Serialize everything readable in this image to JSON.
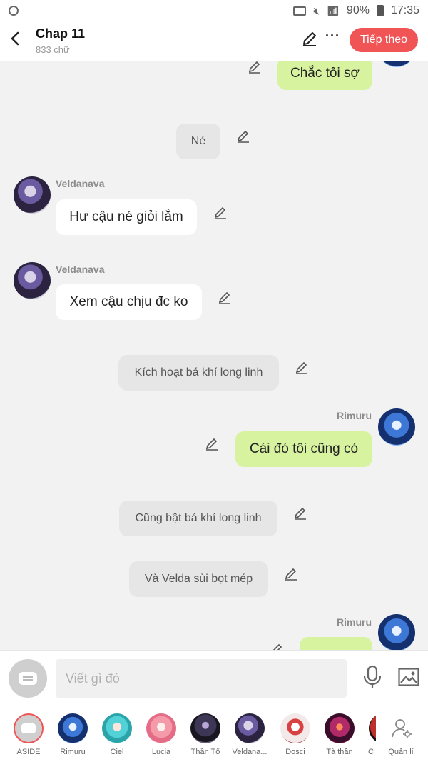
{
  "status_bar": {
    "battery": "90%",
    "time": "17:35"
  },
  "header": {
    "title": "Chap 11",
    "subtitle": "833 chữ",
    "next_button": "Tiếp theo"
  },
  "messages": [
    {
      "type": "right",
      "text": "Chắc tôi sợ"
    },
    {
      "type": "center",
      "text": "Né"
    },
    {
      "type": "left",
      "sender": "Veldanava",
      "text": "Hư cậu né giỏi lắm"
    },
    {
      "type": "left",
      "sender": "Veldanava",
      "text": "Xem cậu chịu đc ko"
    },
    {
      "type": "center",
      "text": "Kích hoạt bá khí long linh"
    },
    {
      "type": "right",
      "sender": "Rimuru",
      "text": "Cái đó tôi cũng có"
    },
    {
      "type": "center",
      "text": "Cũng bật bá khí long linh"
    },
    {
      "type": "center",
      "text": "Và Velda sùi bọt mép"
    },
    {
      "type": "right",
      "sender": "Rimuru",
      "text": ""
    }
  ],
  "input": {
    "placeholder": "Viết gì đó"
  },
  "characters": [
    {
      "name": "ASIDE",
      "icon": "aside-icon"
    },
    {
      "name": "Rimuru",
      "icon": "rimuru-avatar"
    },
    {
      "name": "Ciel",
      "icon": "ciel-avatar"
    },
    {
      "name": "Lucia",
      "icon": "lucia-avatar"
    },
    {
      "name": "Thần Tổ",
      "icon": "than-to-avatar"
    },
    {
      "name": "Veldana...",
      "icon": "veldanava-avatar"
    },
    {
      "name": "Dosci",
      "icon": "dosci-avatar"
    },
    {
      "name": "Tà thần",
      "icon": "ta-than-avatar"
    },
    {
      "name": "C",
      "icon": "c-avatar"
    },
    {
      "name": "Quản lí",
      "icon": "manage-icon"
    }
  ],
  "colors": {
    "accent": "#f05455",
    "right_bubble": "#d7f3a0",
    "left_bubble": "#ffffff",
    "narration_bubble": "#e6e6e6",
    "chat_bg": "#f2f2f2"
  }
}
